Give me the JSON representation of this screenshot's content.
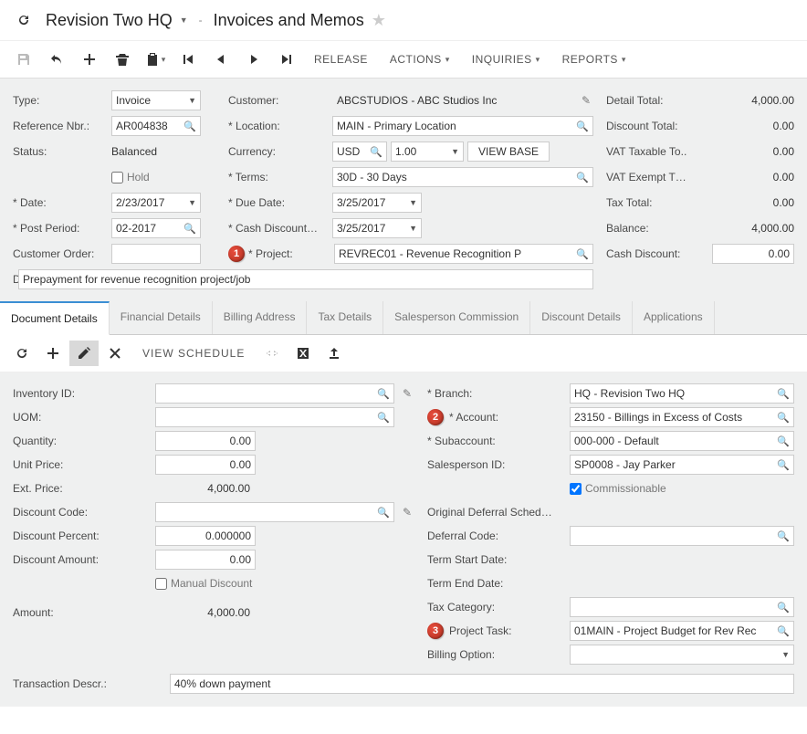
{
  "titlebar": {
    "company": "Revision Two HQ",
    "screen": "Invoices and Memos"
  },
  "toolbar": {
    "release": "RELEASE",
    "actions": "ACTIONS",
    "inquiries": "INQUIRIES",
    "reports": "REPORTS"
  },
  "header": {
    "type_label": "Type:",
    "type_value": "Invoice",
    "refnbr_label": "Reference Nbr.:",
    "refnbr_value": "AR004838",
    "status_label": "Status:",
    "status_value": "Balanced",
    "hold_label": "Hold",
    "date_label": "Date:",
    "date_value": "2/23/2017",
    "postperiod_label": "Post Period:",
    "postperiod_value": "02-2017",
    "custorder_label": "Customer Order:",
    "custorder_value": "",
    "description_label": "Description:",
    "description_value": "Prepayment for revenue recognition project/job",
    "customer_label": "Customer:",
    "customer_value": "ABCSTUDIOS - ABC Studios Inc",
    "location_label": "Location:",
    "location_value": "MAIN - Primary Location",
    "currency_label": "Currency:",
    "currency_value": "USD",
    "currency_rate": "1.00",
    "viewbase": "VIEW BASE",
    "terms_label": "Terms:",
    "terms_value": "30D - 30 Days",
    "duedate_label": "Due Date:",
    "duedate_value": "3/25/2017",
    "cashdisc_label": "Cash Discount…",
    "cashdisc_value": "3/25/2017",
    "project_label": "Project:",
    "project_value": "REVREC01 - Revenue Recognition P"
  },
  "totals": {
    "detail_total_label": "Detail Total:",
    "detail_total": "4,000.00",
    "discount_total_label": "Discount Total:",
    "discount_total": "0.00",
    "vat_taxable_label": "VAT Taxable To..",
    "vat_taxable": "0.00",
    "vat_exempt_label": "VAT Exempt T…",
    "vat_exempt": "0.00",
    "tax_total_label": "Tax Total:",
    "tax_total": "0.00",
    "balance_label": "Balance:",
    "balance": "4,000.00",
    "cash_discount_label": "Cash Discount:",
    "cash_discount": "0.00"
  },
  "tabs": {
    "doc_details": "Document Details",
    "fin_details": "Financial Details",
    "billing_addr": "Billing Address",
    "tax_details": "Tax Details",
    "sales_comm": "Salesperson Commission",
    "disc_details": "Discount Details",
    "applications": "Applications"
  },
  "gridbar": {
    "view_schedule": "VIEW SCHEDULE"
  },
  "details": {
    "inventory_label": "Inventory ID:",
    "inventory_value": "",
    "uom_label": "UOM:",
    "uom_value": "",
    "qty_label": "Quantity:",
    "qty_value": "0.00",
    "unitprice_label": "Unit Price:",
    "unitprice_value": "0.00",
    "extprice_label": "Ext. Price:",
    "extprice_value": "4,000.00",
    "disccode_label": "Discount Code:",
    "disccode_value": "",
    "discpct_label": "Discount Percent:",
    "discpct_value": "0.000000",
    "discamt_label": "Discount Amount:",
    "discamt_value": "0.00",
    "manualdisc_label": "Manual Discount",
    "amount_label": "Amount:",
    "amount_value": "4,000.00",
    "branch_label": "Branch:",
    "branch_value": "HQ - Revision Two HQ",
    "account_label": "Account:",
    "account_value": "23150 - Billings in Excess of Costs",
    "subaccount_label": "Subaccount:",
    "subaccount_value": "000-000 - Default",
    "salesperson_label": "Salesperson ID:",
    "salesperson_value": "SP0008 - Jay Parker",
    "commissionable_label": "Commissionable",
    "origdefer_label": "Original Deferral Sched…",
    "defercode_label": "Deferral Code:",
    "termstart_label": "Term Start Date:",
    "termend_label": "Term End Date:",
    "taxcat_label": "Tax Category:",
    "projecttask_label": "Project Task:",
    "projecttask_value": "01MAIN - Project Budget for Rev Rec",
    "billingopt_label": "Billing Option:",
    "transdesc_label": "Transaction Descr.:",
    "transdesc_value": "40% down payment"
  },
  "callouts": {
    "c1": "1",
    "c2": "2",
    "c3": "3"
  }
}
